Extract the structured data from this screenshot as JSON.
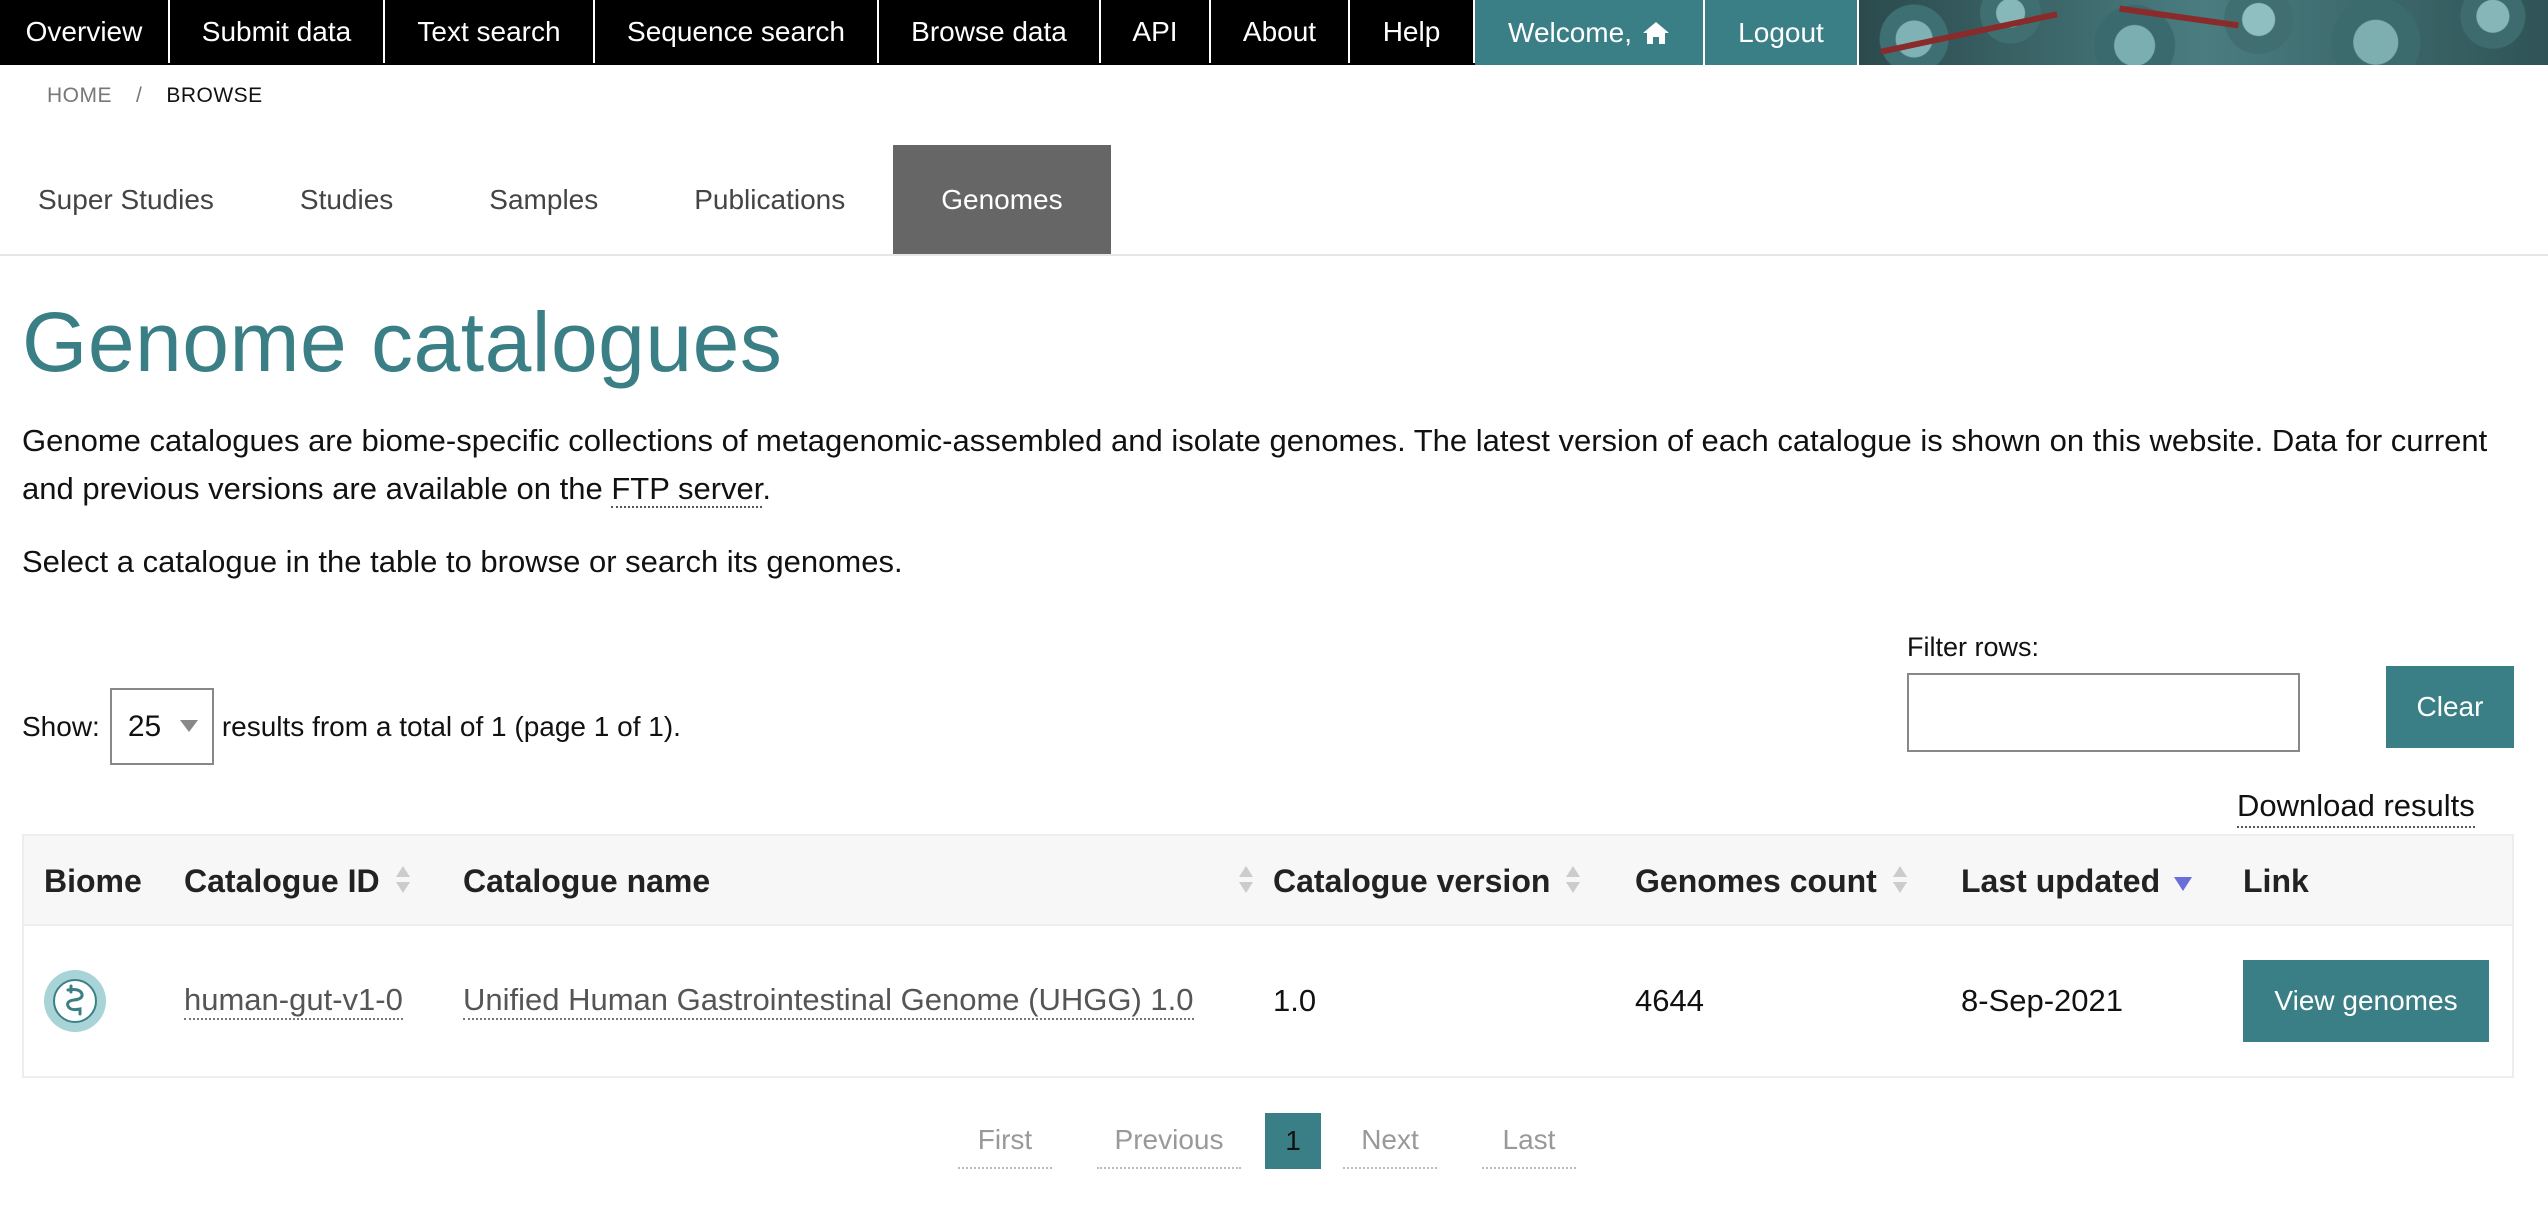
{
  "nav": {
    "items": [
      "Overview",
      "Submit data",
      "Text search",
      "Sequence search",
      "Browse data",
      "API",
      "About",
      "Help"
    ],
    "welcome": "Welcome,",
    "logout": "Logout"
  },
  "breadcrumb": {
    "home": "HOME",
    "separator": "/",
    "current": "BROWSE"
  },
  "tabs": [
    "Super Studies",
    "Studies",
    "Samples",
    "Publications",
    "Genomes"
  ],
  "active_tab": "Genomes",
  "page": {
    "title": "Genome catalogues",
    "description_1": "Genome catalogues are biome-specific collections of metagenomic-assembled and isolate genomes. The latest version of each catalogue is shown on this website. Data for current and previous versions are available on the ",
    "ftp_link": "FTP server",
    "description_2": ".",
    "select_note": "Select a catalogue in the table to browse or search its genomes."
  },
  "controls": {
    "show_label": "Show:",
    "page_size": "25",
    "results_text": "results from a total of 1 (page 1 of 1).",
    "filter_label": "Filter rows:",
    "filter_value": "",
    "clear": "Clear",
    "download": "Download results"
  },
  "table": {
    "headers": [
      "Biome",
      "Catalogue ID",
      "Catalogue name",
      "Catalogue version",
      "Genomes count",
      "Last updated",
      "Link"
    ],
    "rows": [
      {
        "biome_icon": "human-digestive-system-icon",
        "catalogue_id": "human-gut-v1-0",
        "catalogue_name": "Unified Human Gastrointestinal Genome (UHGG) 1.0",
        "version": "1.0",
        "genomes_count": "4644",
        "last_updated": "8-Sep-2021",
        "link": "View genomes"
      }
    ]
  },
  "pagination": {
    "first": "First",
    "previous": "Previous",
    "current": "1",
    "next": "Next",
    "last": "Last"
  },
  "colors": {
    "accent": "#3b7f86",
    "tab_active": "#666666",
    "sort_active": "#6a6ed8"
  }
}
